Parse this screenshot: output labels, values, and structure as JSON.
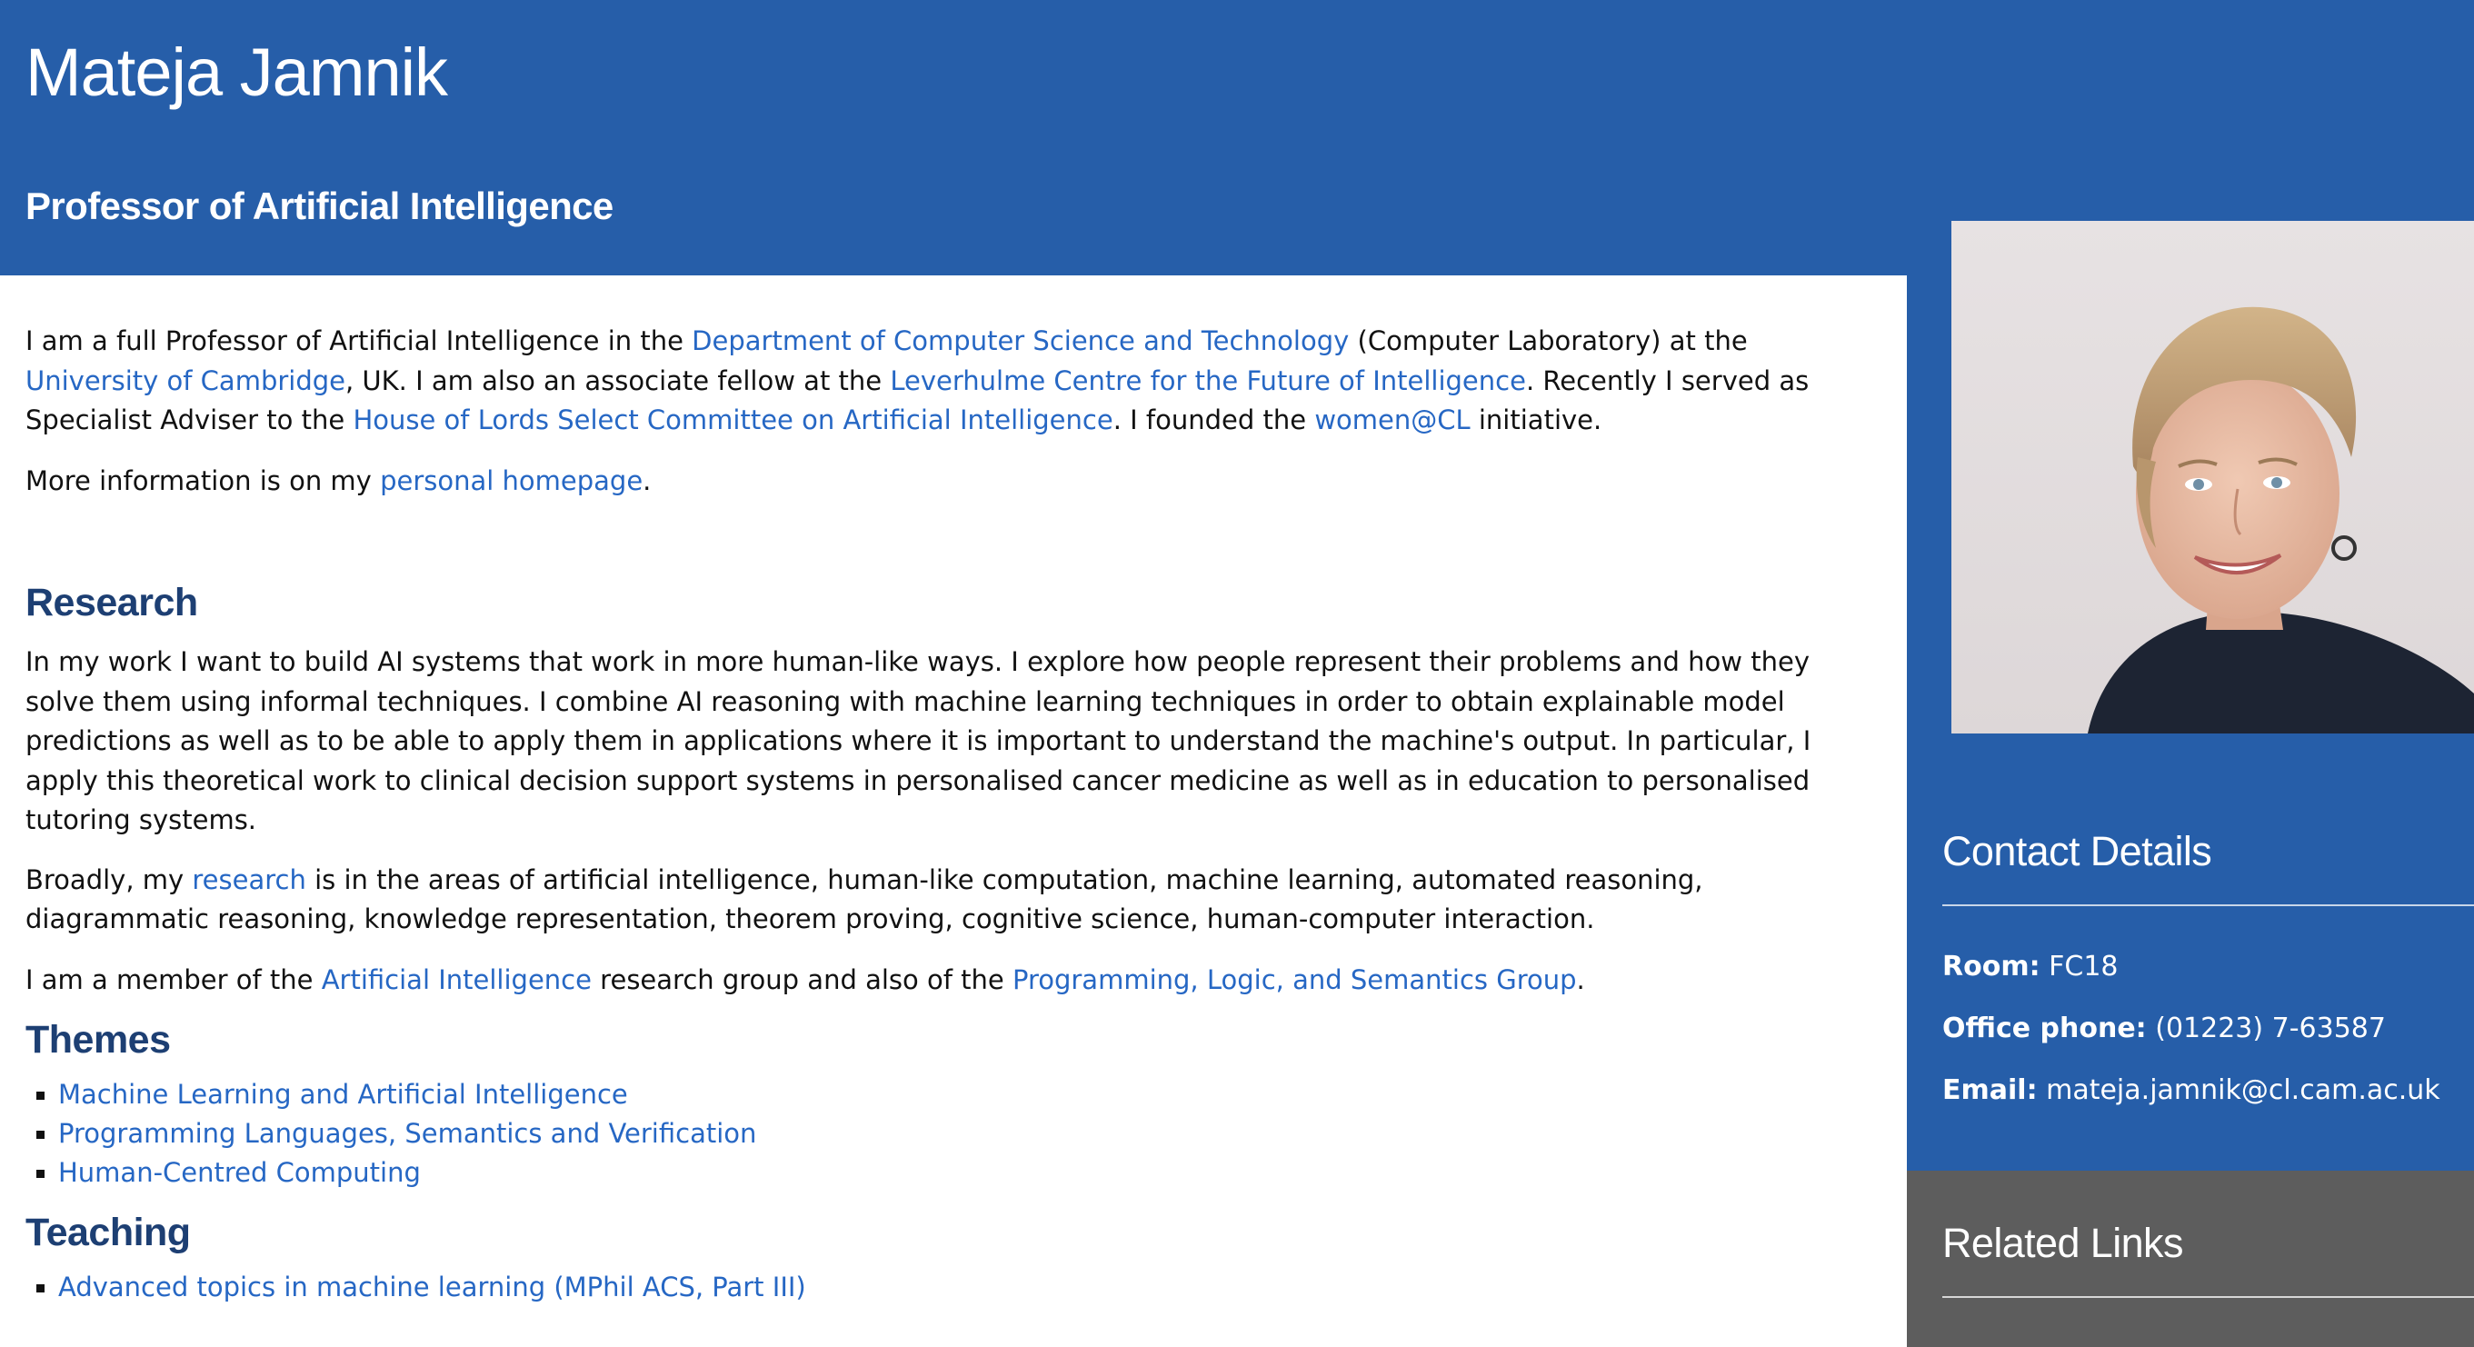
{
  "header": {
    "name": "Mateja Jamnik",
    "title": "Professor of Artificial Intelligence"
  },
  "intro": {
    "p1_a": "I am a full Professor of Artificial Intelligence in the ",
    "p1_link_dept": "Department of Computer Science and Technology",
    "p1_b": " (Computer Laboratory) at the ",
    "p1_link_uni": "University of Cambridge",
    "p1_c": ", UK. I am also an associate fellow at the ",
    "p1_link_lcfi": "Leverhulme Centre for the Future of Intelligence",
    "p1_d": ". Recently I served as Specialist Adviser to the ",
    "p1_link_lords": "House of Lords Select Committee on Artificial Intelligence",
    "p1_e": ". I founded the ",
    "p1_link_women": "women@CL",
    "p1_f": " initiative.",
    "p2_a": "More information is on my ",
    "p2_link_home": "personal homepage",
    "p2_b": "."
  },
  "research": {
    "heading": "Research",
    "p1": "In my work I want to build AI systems that work in more human-like ways. I explore how people represent their problems and how they solve them using informal techniques. I combine AI reasoning with machine learning techniques in order to obtain explainable model predictions as well as to be able to apply them in applications where it is important to understand the machine's output. In particular, I apply this theoretical work to clinical decision support systems in personalised cancer medicine as well as in education to personalised tutoring systems.",
    "p2_a": "Broadly, my ",
    "p2_link": "research",
    "p2_b": " is in the areas of artificial intelligence, human-like computation, machine learning, automated reasoning, diagrammatic reasoning, knowledge representation, theorem proving, cognitive science, human-computer interaction.",
    "p3_a": "I am a member of the ",
    "p3_link_ai": "Artificial Intelligence",
    "p3_b": " research group and also of the ",
    "p3_link_pls": "Programming, Logic, and Semantics Group",
    "p3_c": "."
  },
  "themes": {
    "heading": "Themes",
    "items": [
      {
        "label": "Machine Learning and Artificial Intelligence"
      },
      {
        "label": "Programming Languages, Semantics and Verification"
      },
      {
        "label": "Human-Centred Computing"
      }
    ]
  },
  "teaching": {
    "heading": "Teaching",
    "items": [
      {
        "label": "Advanced topics in machine learning (MPhil ACS, Part III)"
      }
    ]
  },
  "contact": {
    "heading": "Contact Details",
    "room_label": "Room:",
    "room_value": "FC18",
    "phone_label": "Office phone:",
    "phone_value": "(01223) 7-63587",
    "email_label": "Email:",
    "email_value": "mateja.jamnik@cl.cam.ac.uk"
  },
  "related": {
    "heading": "Related Links"
  },
  "colors": {
    "brand_blue": "#265ea9",
    "link_blue": "#2667c4",
    "heading_navy": "#1d3f73",
    "related_gray": "#5d5d5d"
  }
}
